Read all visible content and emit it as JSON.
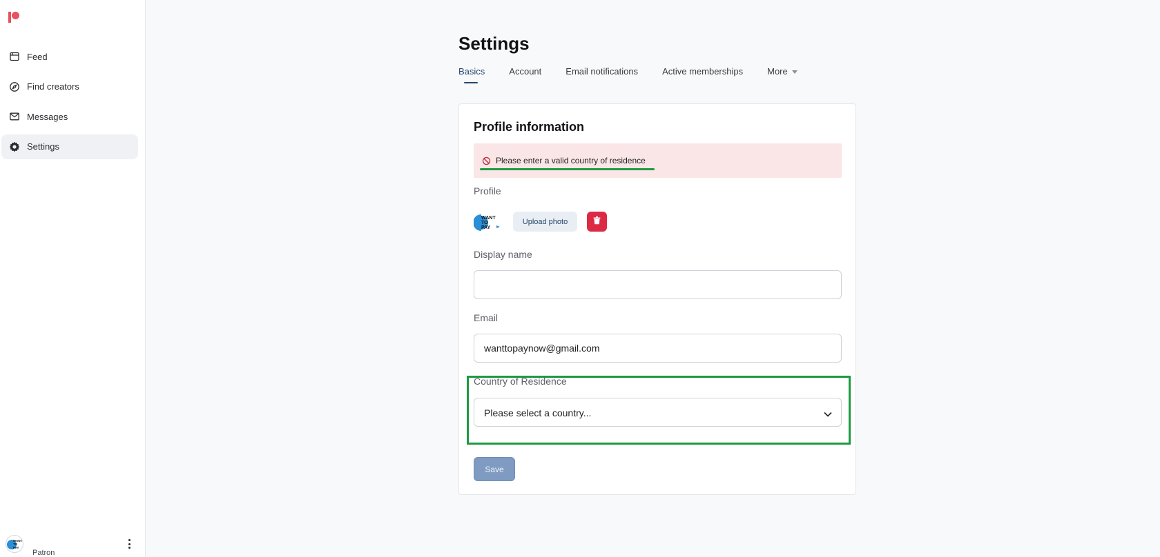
{
  "sidebar": {
    "items": [
      {
        "label": "Feed",
        "icon": "feed-icon"
      },
      {
        "label": "Find creators",
        "icon": "compass-icon"
      },
      {
        "label": "Messages",
        "icon": "mail-icon"
      },
      {
        "label": "Settings",
        "icon": "gear-icon",
        "active": true
      }
    ],
    "user": {
      "role": "Patron",
      "avatar_text": "WANT TO PAY"
    }
  },
  "page": {
    "title": "Settings"
  },
  "tabs": [
    {
      "label": "Basics",
      "active": true
    },
    {
      "label": "Account"
    },
    {
      "label": "Email notifications"
    },
    {
      "label": "Active memberships"
    },
    {
      "label": "More"
    }
  ],
  "profile": {
    "title": "Profile information",
    "alert": "Please enter a valid country of residence",
    "profile_label": "Profile",
    "avatar_text": "WANT TO PAY",
    "upload_label": "Upload photo",
    "display_name_label": "Display name",
    "display_name_value": "",
    "email_label": "Email",
    "email_value": "wanttopaynow@gmail.com",
    "country_label": "Country of Residence",
    "country_value": "Please select a country...",
    "save_label": "Save"
  },
  "colors": {
    "brand": "#e8505b",
    "accent": "#26466b",
    "error_bg": "#fbe6e7",
    "delete": "#dc2a45",
    "highlight": "#1a9a3f"
  }
}
